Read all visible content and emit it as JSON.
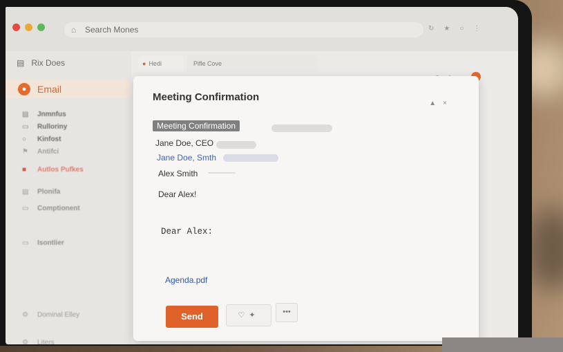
{
  "browser": {
    "address_text": "Search Mones",
    "window_controls": [
      "close",
      "minimize",
      "maximize"
    ],
    "toolbar_icons": [
      "reload-icon",
      "star-icon",
      "extensions-icon",
      "menu-icon"
    ]
  },
  "sidebar": {
    "top_label": "Rix Does",
    "email_label": "Email",
    "items": [
      {
        "label": "Jnmnfus",
        "icon": "inbox-icon"
      },
      {
        "label": "Rulloriny",
        "icon": "folder-icon"
      },
      {
        "label": "Kinfost",
        "icon": "circle-icon"
      },
      {
        "label": "Antifci",
        "icon": "tag-icon"
      },
      {
        "label": "Autlos Pufkes",
        "icon": "alert-icon",
        "accent": "#e07a6b"
      },
      {
        "label": "Plonifa",
        "icon": "file-icon"
      },
      {
        "label": "Comptionent",
        "icon": "folder-icon"
      },
      {
        "label": "Isontlier",
        "icon": "folder-icon"
      },
      {
        "label": "Dominal Elley",
        "icon": "settings-icon"
      },
      {
        "label": "Liters",
        "icon": "settings-icon"
      }
    ]
  },
  "tabs": [
    {
      "label": "Hedi",
      "active": true
    },
    {
      "label": "Pifle Cove",
      "active": false
    }
  ],
  "compose": {
    "title": "Meeting Confirmation",
    "subject": "Meeting Confirmation",
    "to": "Jane Doe, CEO",
    "cc": "Jane Doe, Smth",
    "bcc": "Alex Smith",
    "greeting_1": "Dear Alex!",
    "greeting_2": "Dear Alex:",
    "attachment": "Agenda.pdf",
    "send_label": "Send",
    "more_label": "•••"
  },
  "colors": {
    "accent": "#e0622b",
    "link": "#2d56ad"
  }
}
